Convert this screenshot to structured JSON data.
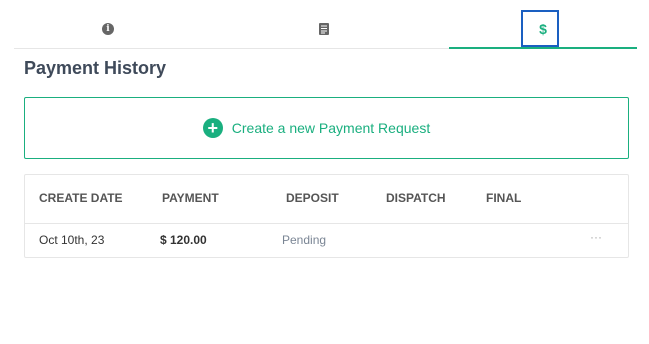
{
  "tabs": [
    {
      "icon": "info-icon",
      "active": false
    },
    {
      "icon": "document-icon",
      "active": false
    },
    {
      "icon": "dollar-icon",
      "glyph": "$",
      "active": true
    }
  ],
  "info_glyph": "i",
  "page_title": "Payment History",
  "new_request": {
    "plus_glyph": "+",
    "label": "Create a new Payment Request"
  },
  "table": {
    "headers": [
      "CREATE DATE",
      "PAYMENT",
      "DEPOSIT",
      "DISPATCH",
      "FINAL"
    ],
    "rows": [
      {
        "create_date": "Oct 10th, 23",
        "payment": "$ 120.00",
        "deposit": "Pending",
        "dispatch": "",
        "final": "",
        "more": "···"
      }
    ]
  },
  "colors": {
    "accent": "#1aaf7f",
    "title": "#3f4a5a",
    "focus_outline": "#1a5fc1"
  }
}
